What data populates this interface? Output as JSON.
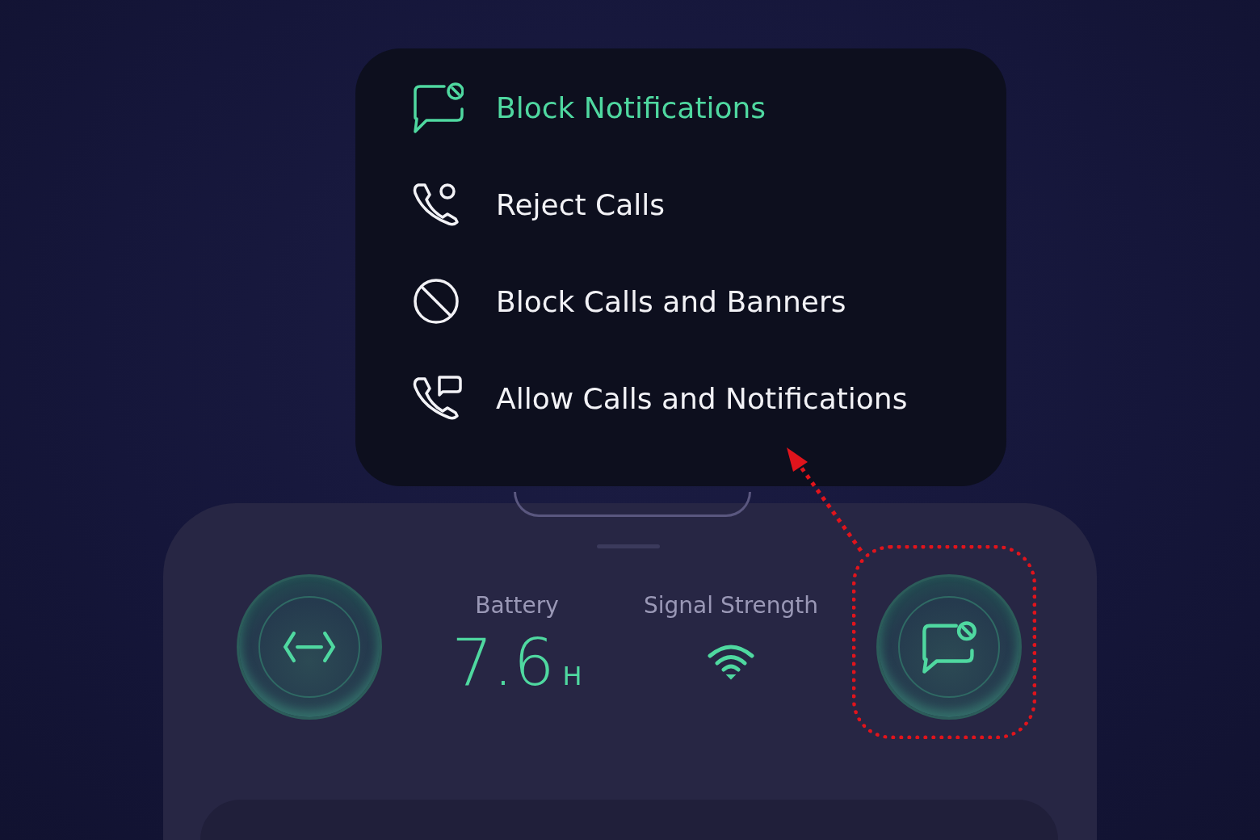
{
  "menu": {
    "items": [
      {
        "label": "Block Notifications",
        "selected": true,
        "kind": "message-block"
      },
      {
        "label": "Reject Calls",
        "selected": false,
        "kind": "phone-circle"
      },
      {
        "label": "Block Calls and Banners",
        "selected": false,
        "kind": "block"
      },
      {
        "label": "Allow Calls and Notifications",
        "selected": false,
        "kind": "phone-message"
      }
    ]
  },
  "panel": {
    "left_button": {
      "kind": "code"
    },
    "battery": {
      "label": "Battery",
      "value": "7.6",
      "unit": "H"
    },
    "signal": {
      "label": "Signal Strength"
    },
    "right_button": {
      "kind": "message-block",
      "highlighted": true
    }
  }
}
